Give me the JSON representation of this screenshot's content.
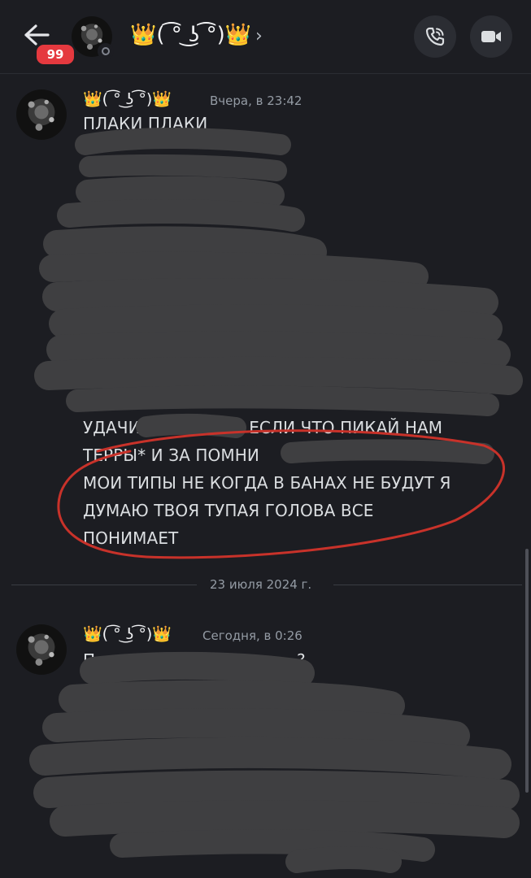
{
  "header": {
    "unread_badge": "99",
    "channel_name": "👑( ͡° ͜ʖ ͡°)👑",
    "chevron": "›",
    "icons": [
      "back-arrow-icon",
      "avatar",
      "status-offline-icon",
      "phone-call-icon",
      "video-camera-icon"
    ]
  },
  "messages": [
    {
      "username": "👑( ͡° ͜ʖ ͡°)👑",
      "timestamp": "Вчера, в 23:42",
      "visible_lines": [
        "ПЛАКИ ПЛАКИ",
        "УДАЧИ",
        "Е ЕСЛИ ЧТО ПИКАЙ НАМ",
        "ТЕРРЫ* И ЗА ПОМНИ",
        "МОИ ТИПЫ НЕ КОГДА В БАНАХ НЕ БУДУТ Я",
        "ДУМАЮ ТВОЯ ТУПАЯ ГОЛОВА ВСЕ",
        "ПОНИМАЕТ"
      ]
    },
    {
      "username": "👑( ͡° ͜ʖ ͡°)👑",
      "timestamp": "Сегодня, в 0:26",
      "visible_lines": [
        "П",
        "?"
      ]
    }
  ],
  "date_divider": "23 июля 2024 г.",
  "colors": {
    "background": "#1c1d22",
    "badge": "#e5393f",
    "redaction": "#3f3f41",
    "annotation_circle": "#c8322a"
  }
}
